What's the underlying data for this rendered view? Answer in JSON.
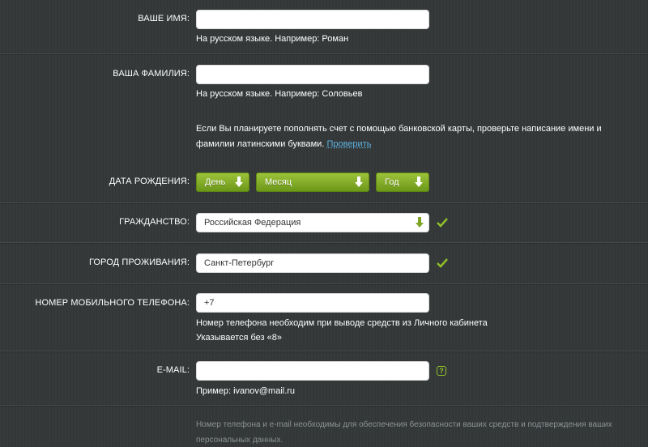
{
  "first_name": {
    "label": "ВАШЕ ИМЯ:",
    "value": "",
    "hint": "На русском языке. Например: Роман"
  },
  "last_name": {
    "label": "ВАША ФАМИЛИЯ:",
    "value": "",
    "hint": "На русском языке. Например: Соловьев"
  },
  "card_note": {
    "text": "Если Вы планируете пополнять счет с помощью банковской карты, проверьте написание имени и фамилии латинскими буквами.",
    "link": "Проверить"
  },
  "birth_date": {
    "label": "ДАТА РОЖДЕНИЯ:",
    "day": "День",
    "month": "Месяц",
    "year": "Год"
  },
  "citizenship": {
    "label": "ГРАЖДАНСТВО:",
    "value": "Российская Федерация"
  },
  "city": {
    "label": "ГОРОД ПРОЖИВАНИЯ:",
    "value": "Санкт-Петербург"
  },
  "phone": {
    "label": "НОМЕР МОБИЛЬНОГО ТЕЛЕФОНА:",
    "value": "+7",
    "hint1": "Номер телефона необходим при выводе средств из Личного кабинета",
    "hint2": "Указывается без «8»"
  },
  "email": {
    "label": "E-MAIL:",
    "value": "",
    "help": "?",
    "hint": "Пример: ivanov@mail.ru"
  },
  "security_note": "Номер телефона и e-mail необходимы для обеспечения безопасности ваших средств и подтверждения ваших персональных данных.",
  "colors": {
    "accent_green": "#8fbf2a",
    "link_blue": "#5eb4e3",
    "background": "#343839"
  },
  "icons": {
    "dropdown": "down-arrow-icon",
    "valid": "checkmark-icon",
    "help": "question-icon"
  }
}
